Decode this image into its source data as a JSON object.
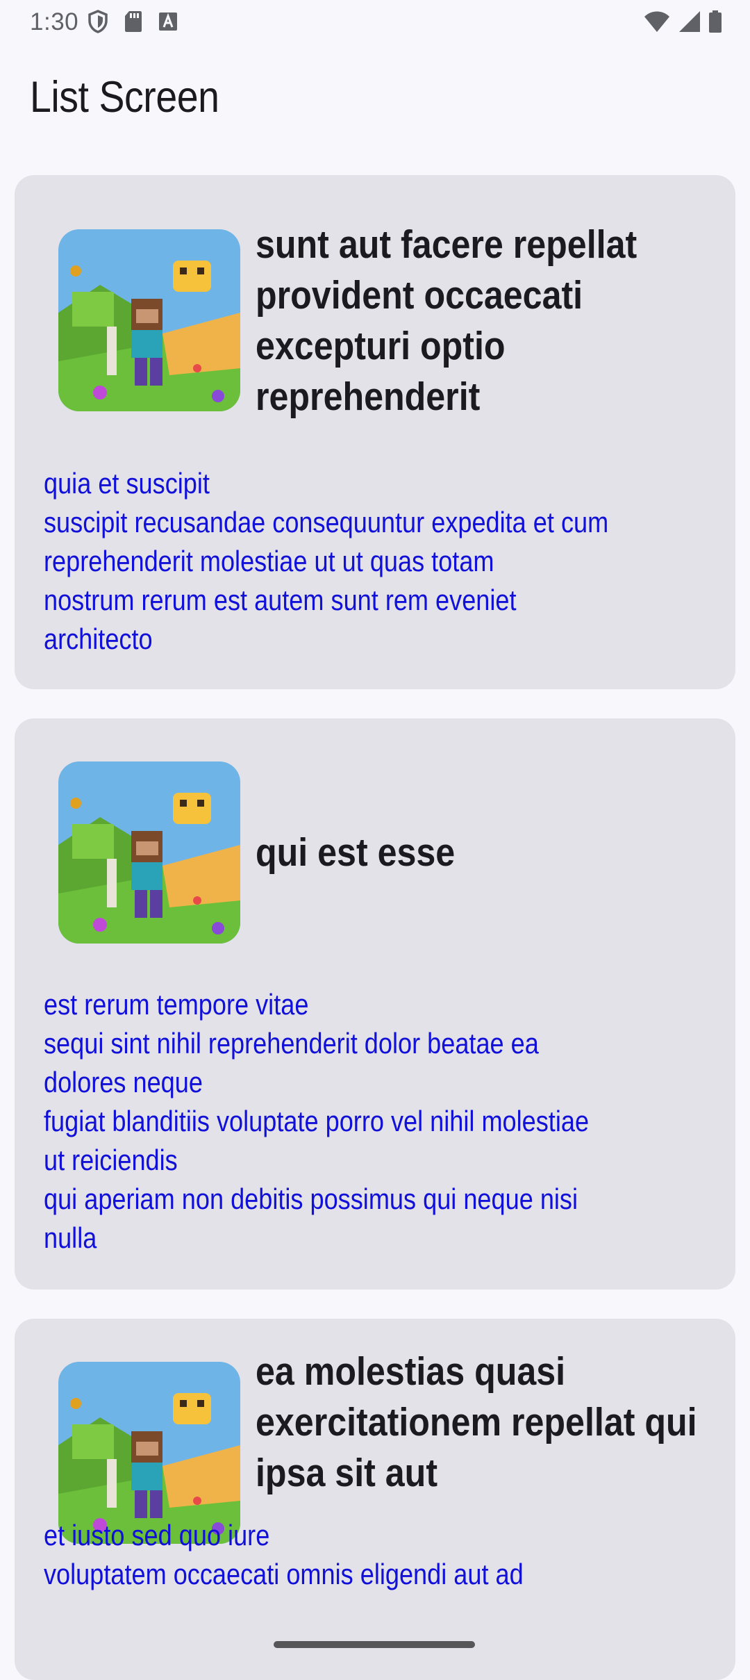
{
  "status_bar": {
    "time": "1:30",
    "left_icons": [
      "shield-icon",
      "sd-card-icon",
      "font-a-icon"
    ],
    "right_icons": [
      "wifi-icon",
      "cell-signal-icon",
      "battery-icon"
    ]
  },
  "app_bar": {
    "title": "List Screen"
  },
  "posts": [
    {
      "title": "sunt aut facere repellat provident occaecati excepturi optio reprehenderit",
      "body": "quia et suscipit\nsuscipit recusandae consequuntur expedita et cum\nreprehenderit molestiae ut ut quas totam\nnostrum rerum est autem sunt rem eveniet\narchitecto",
      "thumbnail": "game-artwork-image"
    },
    {
      "title": "qui est esse",
      "body": "est rerum tempore vitae\nsequi sint nihil reprehenderit dolor beatae ea\ndolores neque\nfugiat blanditiis voluptate porro vel nihil molestiae\nut reiciendis\nqui aperiam non debitis possimus qui neque nisi\nnulla",
      "thumbnail": "game-artwork-image"
    },
    {
      "title": "ea molestias quasi exercitationem repellat qui ipsa sit aut",
      "body": "et iusto sed quo iure\nvoluptatem occaecati omnis eligendi aut ad",
      "thumbnail": "game-artwork-image"
    }
  ],
  "colors": {
    "background": "#f7f7fc",
    "card": "#e3e2e8",
    "title_text": "#1b1b1f",
    "body_text": "#1010d8"
  }
}
